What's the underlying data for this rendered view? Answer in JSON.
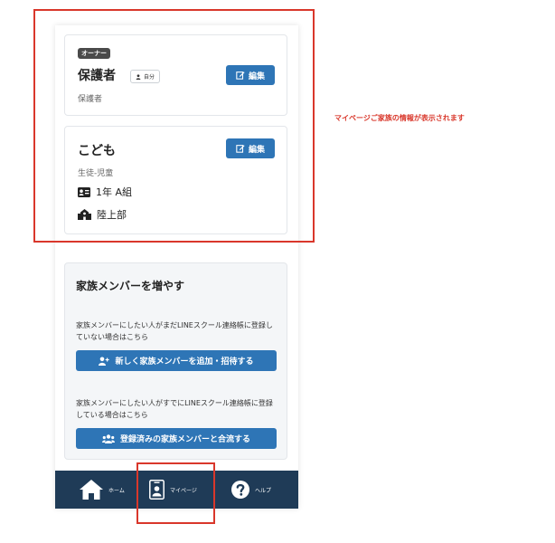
{
  "owner_card": {
    "badge": "オーナー",
    "name": "保護者",
    "self_tag": "自分",
    "role": "保護者",
    "edit_label": "編集"
  },
  "child_card": {
    "name": "こども",
    "role": "生徒-児童",
    "class": "1年 A組",
    "club": "陸上部",
    "edit_label": "編集"
  },
  "add_family": {
    "title": "家族メンバーを増やす",
    "desc_new": "家族メンバーにしたい人がまだLINEスクール連絡帳に登録していない場合はこちら",
    "btn_new": "新しく家族メンバーを追加・招待する",
    "desc_join": "家族メンバーにしたい人がすでにLINEスクール連絡帳に登録している場合はこちら",
    "btn_join": "登録済みの家族メンバーと合流する"
  },
  "nav": {
    "home": "ホーム",
    "mypage": "マイページ",
    "help": "ヘルプ"
  },
  "annotation": "マイページご家族の情報が表示されます",
  "colors": {
    "primary": "#2e75b6",
    "navbar": "#1f3b57",
    "highlight": "#d9372b"
  }
}
